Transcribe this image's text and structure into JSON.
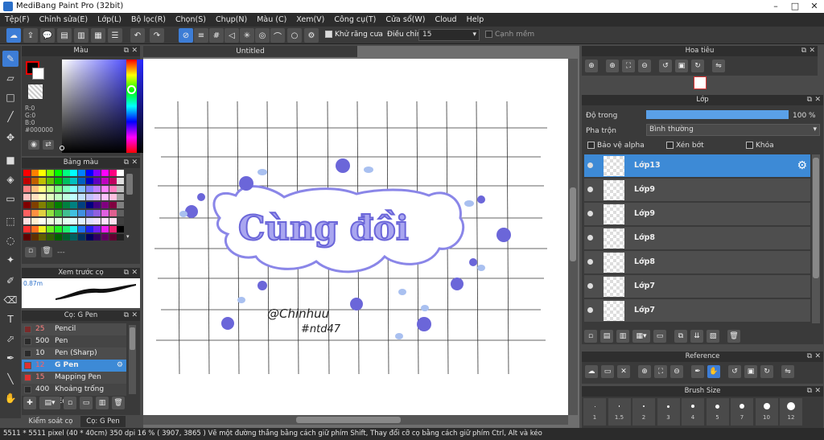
{
  "window": {
    "title": "MediBang Paint Pro (32bit)"
  },
  "menu": [
    "Tệp(F)",
    "Chỉnh sửa(E)",
    "Lớp(L)",
    "Bộ lọc(R)",
    "Chọn(S)",
    "Chụp(N)",
    "Màu (C)",
    "Xem(V)",
    "Công cụ(T)",
    "Cửa sổ(W)",
    "Cloud",
    "Help"
  ],
  "toolbar": {
    "antialias_label": "Khử răng cưa",
    "correction_label": "Điều chỉnh",
    "correction_value": "15",
    "snap_label": "Cạnh mềm"
  },
  "color_panel": {
    "title": "Màu",
    "r": "R:0",
    "g": "G:0",
    "b": "B:0",
    "hex": "#000000",
    "main_color": "#000000"
  },
  "palette_panel": {
    "title": "Bảng màu",
    "footer": "---"
  },
  "brush_preview": {
    "title": "Xem trước cọ",
    "size_text": "0.87m"
  },
  "brush_panel": {
    "title": "Cọ: G Pen",
    "items": [
      {
        "size": "25",
        "name": "Pencil",
        "color": "#7a2a2a",
        "selected": false
      },
      {
        "size": "500",
        "name": "Pen",
        "color": "#2a2a2a",
        "selected": false
      },
      {
        "size": "10",
        "name": "Pen (Sharp)",
        "color": "#2a2a2a",
        "selected": false
      },
      {
        "size": "12",
        "name": "G Pen",
        "color": "#e03030",
        "selected": true
      },
      {
        "size": "15",
        "name": "Mapping Pen",
        "color": "#e03030",
        "selected": false
      },
      {
        "size": "400",
        "name": "Khoảng trống [Edge",
        "color": "#2a2a2a",
        "selected": false
      }
    ]
  },
  "bottom_tabs": [
    "Kiểm soát cọ",
    "Cọ: G Pen"
  ],
  "document": {
    "tab_title": "Untitled",
    "artwork_text": "Cùng đồi",
    "signature": "@Chinhuu",
    "tag": "#ntd47"
  },
  "navigator": {
    "title": "Hoa tiêu"
  },
  "layer_panel": {
    "title": "Lớp",
    "opacity_label": "Độ trong",
    "opacity_value": "100 %",
    "opacity_fraction": 1.0,
    "blend_label": "Pha trộn",
    "blend_value": "Bình thường",
    "protect_alpha": "Bảo vệ alpha",
    "clip": "Xén bớt",
    "lock": "Khóa",
    "layers": [
      {
        "name": "Lớp13",
        "selected": true
      },
      {
        "name": "Lớp9",
        "selected": false
      },
      {
        "name": "Lớp9",
        "selected": false
      },
      {
        "name": "Lớp8",
        "selected": false
      },
      {
        "name": "Lớp8",
        "selected": false
      },
      {
        "name": "Lớp7",
        "selected": false
      },
      {
        "name": "Lớp7",
        "selected": false
      }
    ]
  },
  "reference_panel": {
    "title": "Reference"
  },
  "brush_size_panel": {
    "title": "Brush Size",
    "sizes": [
      "1",
      "1.5",
      "2",
      "3",
      "4",
      "5",
      "7",
      "10",
      "12"
    ]
  },
  "status": {
    "text": "5511 * 5511 pixel  (40 * 40cm)  350 dpi  16 %  ( 3907, 3865 )  Vẽ một đường thẳng bằng cách giữ phím Shift, Thay đổi cỡ cọ bằng cách giữ phím Ctrl, Alt và kéo"
  }
}
